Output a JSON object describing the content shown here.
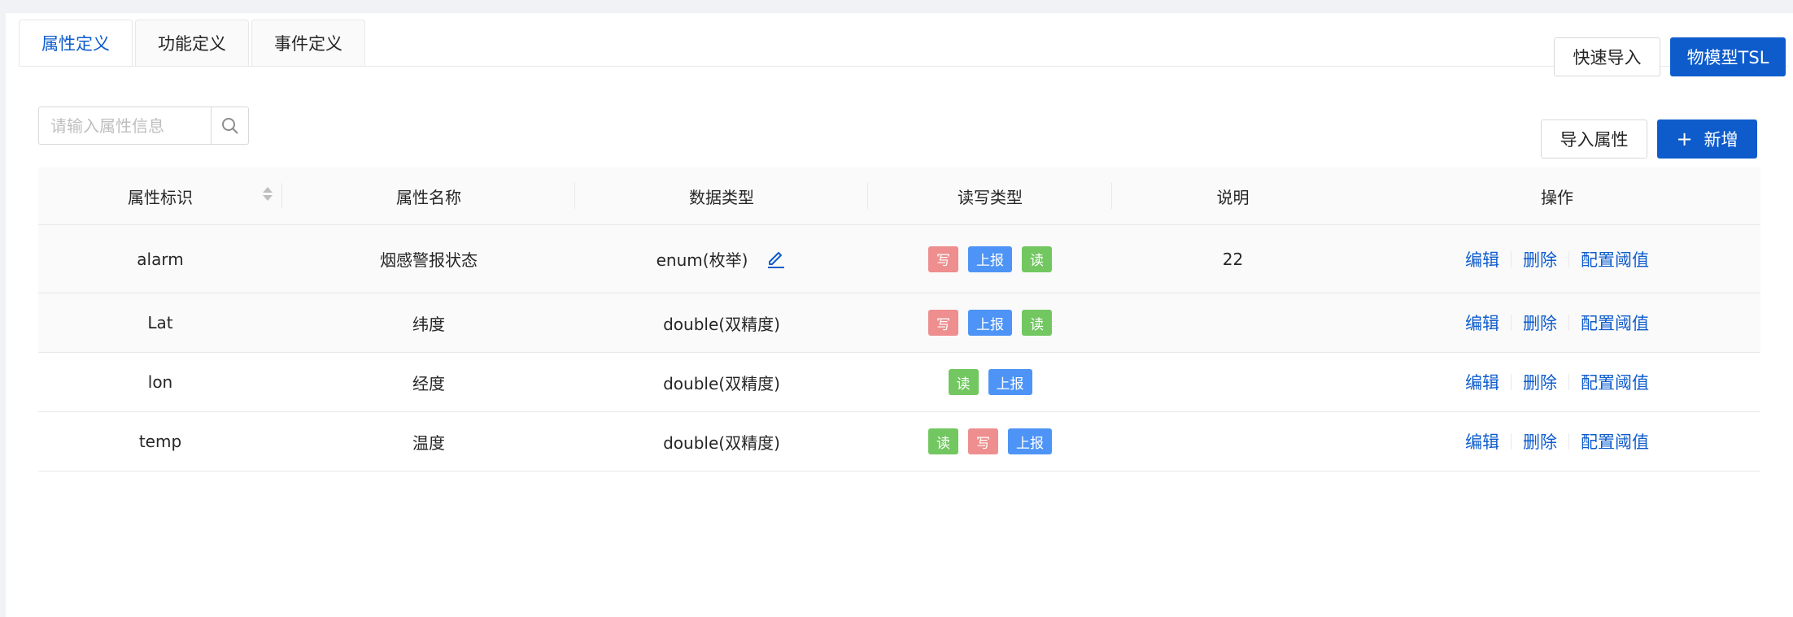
{
  "tabs": [
    {
      "label": "属性定义",
      "active": true
    },
    {
      "label": "功能定义",
      "active": false
    },
    {
      "label": "事件定义",
      "active": false
    }
  ],
  "top_actions": {
    "quick_import": "快速导入",
    "tsl": "物模型TSL"
  },
  "search": {
    "placeholder": "请输入属性信息"
  },
  "toolbar": {
    "import_label": "导入属性",
    "add_label": "新增",
    "add_icon": "+"
  },
  "table": {
    "headers": [
      "属性标识",
      "属性名称",
      "数据类型",
      "读写类型",
      "说明",
      "操作"
    ],
    "rows": [
      {
        "id": "alarm",
        "name": "烟感警报状态",
        "type": "enum(枚举)",
        "editable_type": true,
        "rw": [
          "写",
          "上报",
          "读"
        ],
        "desc": "22"
      },
      {
        "id": "Lat",
        "name": "纬度",
        "type": "double(双精度)",
        "editable_type": false,
        "rw": [
          "写",
          "上报",
          "读"
        ],
        "desc": ""
      },
      {
        "id": "lon",
        "name": "经度",
        "type": "double(双精度)",
        "editable_type": false,
        "rw": [
          "读",
          "上报"
        ],
        "desc": ""
      },
      {
        "id": "temp",
        "name": "温度",
        "type": "double(双精度)",
        "editable_type": false,
        "rw": [
          "读",
          "写",
          "上报"
        ],
        "desc": ""
      }
    ],
    "ops": {
      "edit": "编辑",
      "delete": "删除",
      "threshold": "配置阈值"
    }
  },
  "colors": {
    "primary": "#0e5ccc",
    "tag_write": "#ee8e8e",
    "tag_report": "#4d94f6",
    "tag_read": "#72c761"
  }
}
